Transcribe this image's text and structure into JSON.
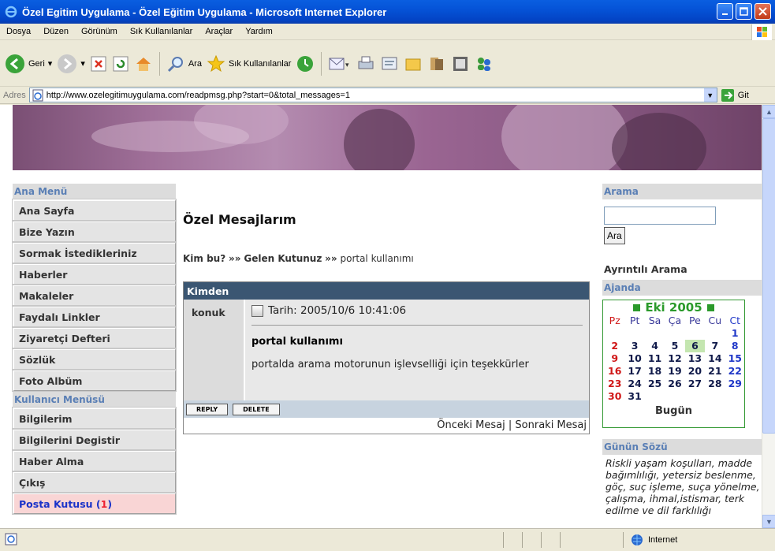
{
  "window": {
    "title": "Özel Egitim Uygulama - Özel Eğitim Uygulama - Microsoft Internet Explorer"
  },
  "menubar": {
    "items": [
      "Dosya",
      "Düzen",
      "Görünüm",
      "Sık Kullanılanlar",
      "Araçlar",
      "Yardım"
    ]
  },
  "toolbar": {
    "back": "Geri",
    "search": "Ara",
    "favorites": "Sık Kullanılanlar"
  },
  "address": {
    "label": "Adres",
    "url": "http://www.ozelegitimuygulama.com/readpmsg.php?start=0&total_messages=1",
    "go": "Git"
  },
  "status": {
    "zone": "Internet"
  },
  "leftmenu": {
    "main_title": "Ana Menü",
    "main_items": [
      "Ana Sayfa",
      "Bize Yazın",
      "Sormak İstedikleriniz",
      "Haberler",
      "Makaleler",
      "Faydalı Linkler",
      "Ziyaretçi Defteri",
      "Sözlük",
      "Foto Albüm"
    ],
    "user_title": "Kullanıcı Menüsü",
    "user_items": [
      "Bilgilerim",
      "Bilgilerini Degistir",
      "Haber Alma",
      "Çıkış"
    ],
    "inbox_label": "Posta Kutusu (",
    "inbox_count": "1",
    "inbox_close": ")"
  },
  "main": {
    "title": "Özel Mesajlarım",
    "crumb_who": "Kim bu?",
    "crumb_sep": "»»",
    "crumb_inbox": "Gelen Kutunuz",
    "crumb_subject": "portal kullanımı",
    "msg_header": "Kimden",
    "sender": "konuk",
    "date": "Tarih: 2005/10/6 10:41:06",
    "subject": "portal kullanımı",
    "body": "portalda arama motorunun işlevselliği için teşekkürler",
    "reply": "REPLY",
    "delete": "DELETE",
    "prev": "Önceki Mesaj",
    "navsep": "|",
    "next": "Sonraki Mesaj"
  },
  "right": {
    "search_title": "Arama",
    "search_value": "",
    "search_btn": "Ara",
    "advanced": "Ayrıntılı Arama",
    "agenda_title": "Ajanda",
    "calendar": {
      "month": "Eki 2005",
      "days": [
        "Pz",
        "Pt",
        "Sa",
        "Ça",
        "Pe",
        "Cu",
        "Ct"
      ],
      "today_label": "Bugün",
      "today_date": 6
    },
    "quote_title": "Günün Sözü",
    "quote": "Riskli yaşam koşulları, madde bağımlılığı, yetersiz beslenme, göç, suç işleme, suça yönelme, çalışma, ihmal,istismar, terk edilme ve dil farklılığı"
  }
}
